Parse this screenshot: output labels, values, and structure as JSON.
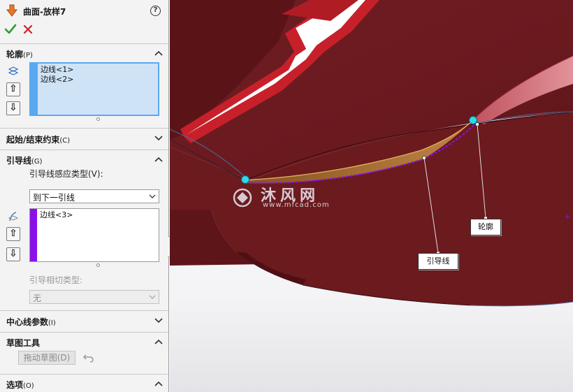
{
  "feature": {
    "title": "曲面-放样7",
    "help": "?"
  },
  "sections": {
    "profiles": {
      "label": "轮廓",
      "key": "(P)",
      "items": [
        "边线<1>",
        "边线<2>"
      ]
    },
    "start_end": {
      "label": "起始/结束约束",
      "key": "(C)"
    },
    "guides": {
      "label": "引导线",
      "key": "(G)",
      "influence_label": "引导线感应类型(V):",
      "influence_value": "到下一引线",
      "items": [
        "边线<3>"
      ],
      "tangency_label": "引导相切类型:",
      "tangency_value": "无"
    },
    "centerline": {
      "label": "中心线参数",
      "key": "(I)"
    },
    "sketch_tools": {
      "label": "草图工具",
      "drag_button": "拖动草图(D)"
    },
    "options": {
      "label": "选项",
      "key": "(O)"
    }
  },
  "viewport": {
    "callouts": {
      "profile": "轮廓",
      "guide": "引导线"
    },
    "watermark": {
      "brand": "沐风网",
      "url": "www.mfcad.com"
    }
  },
  "colors": {
    "profile_bar": "#5aa8f0",
    "guide_bar": "#8a10e8",
    "model_red": "#6b1a1e",
    "accent_ok": "#2aa02a",
    "accent_cancel": "#d0202a"
  }
}
